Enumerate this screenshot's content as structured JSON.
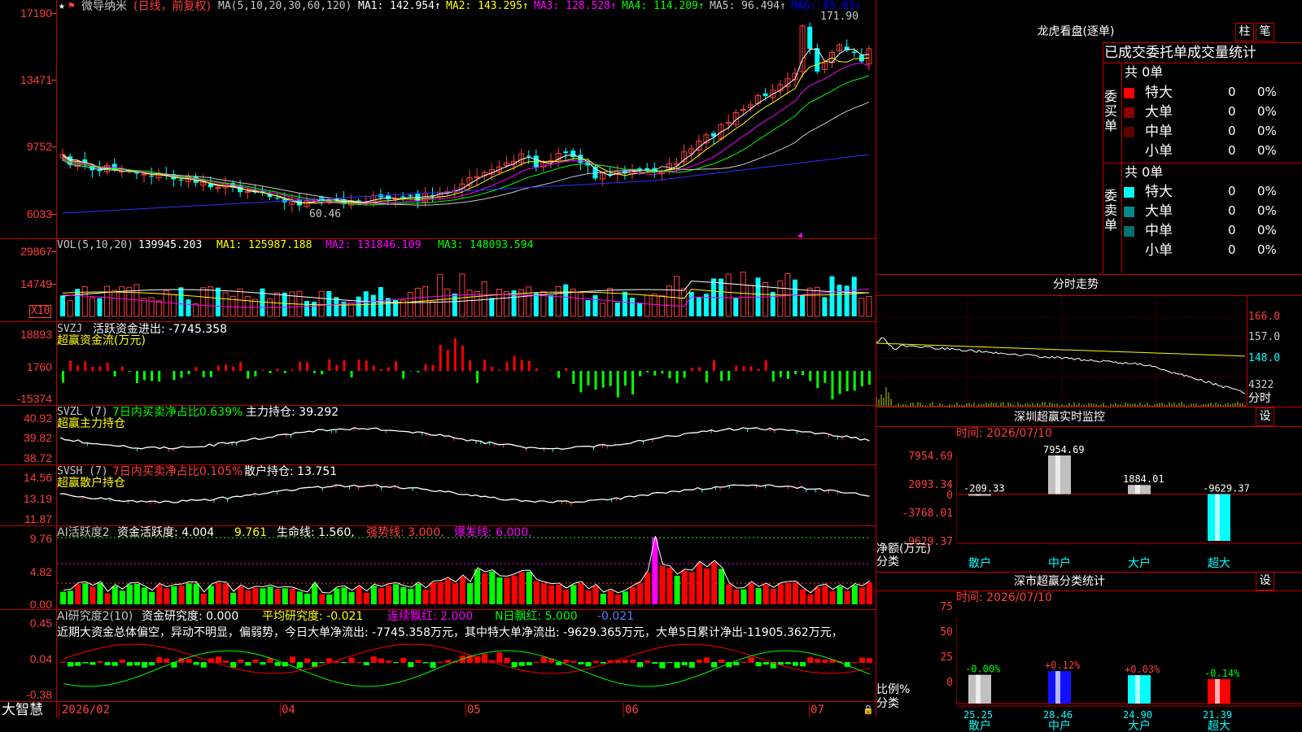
{
  "stock": {
    "name": "微导纳米",
    "adjust": "(日线，前复权)",
    "ma_label": "MA(5,10,20,30,60,120)",
    "ma": [
      {
        "k": "MA1:",
        "v": "142.954",
        "color": "#ffffff"
      },
      {
        "k": "MA2:",
        "v": "143.295",
        "color": "#ffff00"
      },
      {
        "k": "MA3:",
        "v": "128.528",
        "color": "#ff00ff"
      },
      {
        "k": "MA4:",
        "v": "114.209",
        "color": "#00ff00"
      },
      {
        "k": "MA5:",
        "v": "96.494",
        "color": "#c8c8c8"
      },
      {
        "k": "MA6:",
        "v": "85.03",
        "color": "#0000ff"
      }
    ],
    "high_label": "171.90",
    "low_label": "60.46",
    "price_axis": [
      "17190",
      "13471",
      "9752",
      "6033"
    ]
  },
  "vol": {
    "header": "VOL(5,10,20)",
    "value": "139945.203",
    "ma1": "MA1: 125987.188",
    "ma2": "MA2: 131846.109",
    "ma3": "MA3: 148093.594",
    "axis": [
      "29867",
      "14749"
    ],
    "unit": "X10"
  },
  "svzj": {
    "name": "SVZJ",
    "desc": "活跃资金进出: -7745.358",
    "sub": "超赢资金流(万元)",
    "axis": [
      "18893",
      "1760",
      "-15374"
    ]
  },
  "svzl": {
    "name": "SVZL (7)",
    "desc": "7日内买卖净占比0.639%",
    "extra": "主力持仓: 39.292",
    "sub": "超赢主力持仓",
    "axis": [
      "40.92",
      "39.82",
      "38.72"
    ]
  },
  "svsh": {
    "name": "SVSH (7)",
    "desc": "7日内买卖净占比0.105%",
    "extra": "散户持仓: 13.751",
    "sub": "超赢散户持仓",
    "axis": [
      "14.56",
      "13.19",
      "11.87"
    ]
  },
  "huoyue": {
    "name": "AI活跃度2",
    "a": "资金活跃度: 4.004",
    "b": "9.761",
    "c": "生命线: 1.560,",
    "d": "强势线: 3.000,",
    "e": "爆发线: 6.000,",
    "axis": [
      "9.76",
      "4.82",
      "0.00"
    ]
  },
  "yanjiu": {
    "name": "AI研究度2(10)",
    "a": "资金研究度: 0.000",
    "b": "平均研究度: -0.021",
    "c": "连续飘红: 2.000",
    "d": "N日飘红: 5.000",
    "e": "-0.021",
    "summary": "近期大资金总体偏空，异动不明显，偏弱势，今日大单净流出: -7745.358万元，其中特大单净流出: -9629.365万元，大单5日累计净出-11905.362万元，",
    "axis": [
      "0.45",
      "0.04",
      "-0.38"
    ]
  },
  "date_axis": [
    "2026/02",
    "04",
    "05",
    "06",
    "07"
  ],
  "brand": "大智慧",
  "lhb": {
    "title": "龙虎看盘(逐单)",
    "btn1": "柱",
    "btn2": "笔",
    "header": "已成交委托单成交量统计",
    "buy_label": "委买单",
    "sell_label": "委卖单",
    "buy_total": "共 0单",
    "sell_total": "共 0单",
    "buy_rows": [
      {
        "label": "特大",
        "v": "0",
        "p": "0%",
        "color": "#ff0000"
      },
      {
        "label": "大单",
        "v": "0",
        "p": "0%",
        "color": "#8b0000"
      },
      {
        "label": "中单",
        "v": "0",
        "p": "0%",
        "color": "#5a0000"
      },
      {
        "label": "小单",
        "v": "0",
        "p": "0%",
        "color": ""
      }
    ],
    "sell_rows": [
      {
        "label": "特大",
        "v": "0",
        "p": "0%",
        "color": "#00ffff"
      },
      {
        "label": "大单",
        "v": "0",
        "p": "0%",
        "color": "#008b8b"
      },
      {
        "label": "中单",
        "v": "0",
        "p": "0%",
        "color": "#007070"
      },
      {
        "label": "小单",
        "v": "0",
        "p": "0%",
        "color": ""
      }
    ]
  },
  "intraday": {
    "title": "分时走势",
    "axis": [
      "166.0",
      "157.0",
      "148.0",
      "4322"
    ],
    "unit": "分时"
  },
  "monitor": {
    "title": "深圳超赢实时监控",
    "set": "设",
    "time": "时间: 2026/07/10",
    "axis": [
      "7954.69",
      "2093.34",
      "0",
      "-3768.01",
      "-9629.37"
    ],
    "ylabel": "净额(万元)",
    "xlabel": "分类",
    "categories": [
      "散户",
      "中户",
      "大户",
      "超大"
    ],
    "values": [
      -209.33,
      7954.69,
      1884.01,
      -9629.37
    ],
    "value_labels": [
      "-209.33",
      "7954.69",
      "1884.01",
      "-9629.37"
    ]
  },
  "stats": {
    "title": "深市超赢分类统计",
    "set": "设",
    "time": "时间: 2026/07/10",
    "axis": [
      "75",
      "50",
      "25",
      "0"
    ],
    "ylabel": "比例%",
    "xlabel": "分类",
    "categories": [
      "散户",
      "中户",
      "大户",
      "超大"
    ],
    "values": [
      25.25,
      28.46,
      24.9,
      21.39
    ],
    "value_labels": [
      "25.25",
      "28.46",
      "24.90",
      "21.39"
    ],
    "changes": [
      "-0.00%",
      "+0.12%",
      "+0.03%",
      "-0.14%"
    ]
  },
  "chart_data": [
    {
      "type": "bar",
      "title": "深圳超赢实时监控",
      "ylabel": "净额(万元)",
      "xlabel": "分类",
      "categories": [
        "散户",
        "中户",
        "大户",
        "超大"
      ],
      "values": [
        -209.33,
        7954.69,
        1884.01,
        -9629.37
      ],
      "ylim": [
        -9629.37,
        7954.69
      ]
    },
    {
      "type": "bar",
      "title": "深市超赢分类统计",
      "ylabel": "比例%",
      "xlabel": "分类",
      "categories": [
        "散户",
        "中户",
        "大户",
        "超大"
      ],
      "values": [
        25.25,
        28.46,
        24.9,
        21.39
      ],
      "ylim": [
        0,
        75
      ]
    }
  ]
}
